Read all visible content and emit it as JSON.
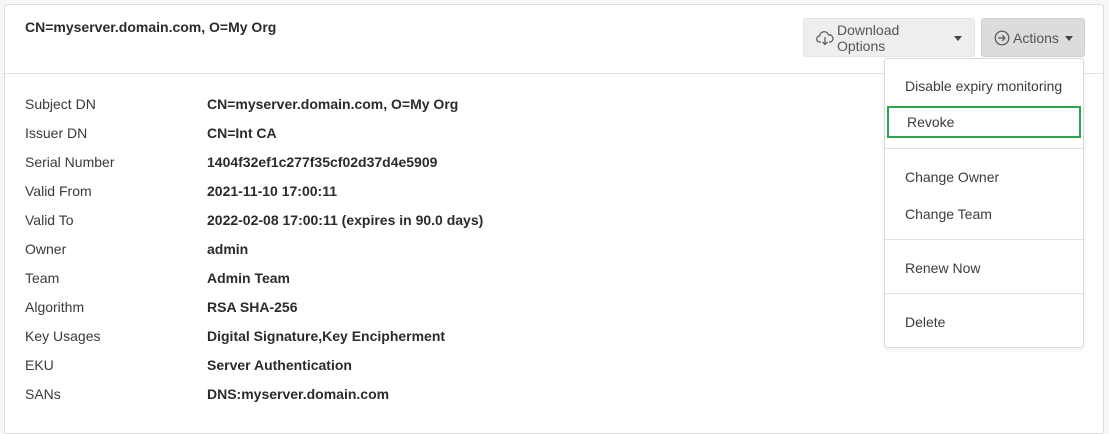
{
  "header": {
    "title": "CN=myserver.domain.com, O=My Org",
    "download_label": "Download Options",
    "actions_label": "Actions"
  },
  "details": [
    {
      "label": "Subject DN",
      "value": "CN=myserver.domain.com, O=My Org"
    },
    {
      "label": "Issuer DN",
      "value": "CN=Int CA"
    },
    {
      "label": "Serial Number",
      "value": "1404f32ef1c277f35cf02d37d4e5909"
    },
    {
      "label": "Valid From",
      "value": "2021-11-10 17:00:11"
    },
    {
      "label": "Valid To",
      "value": "2022-02-08 17:00:11 (expires in 90.0 days)"
    },
    {
      "label": "Owner",
      "value": "admin"
    },
    {
      "label": "Team",
      "value": "Admin Team"
    },
    {
      "label": "Algorithm",
      "value": "RSA SHA-256"
    },
    {
      "label": "Key Usages",
      "value": "Digital Signature,Key Encipherment"
    },
    {
      "label": "EKU",
      "value": "Server Authentication"
    },
    {
      "label": "SANs",
      "value": "DNS:myserver.domain.com"
    }
  ],
  "actions_menu": {
    "items": [
      "Disable expiry monitoring",
      "Revoke",
      "Change Owner",
      "Change Team",
      "Renew Now",
      "Delete"
    ],
    "focused_item": "Revoke"
  },
  "colors": {
    "focus_outline": "#2aa54a",
    "actions_button_bg": "#dcdcdc",
    "download_button_bg": "#eeeeee"
  },
  "icons": {
    "download": "cloud-download-icon",
    "actions": "circle-arrow-right-icon"
  }
}
